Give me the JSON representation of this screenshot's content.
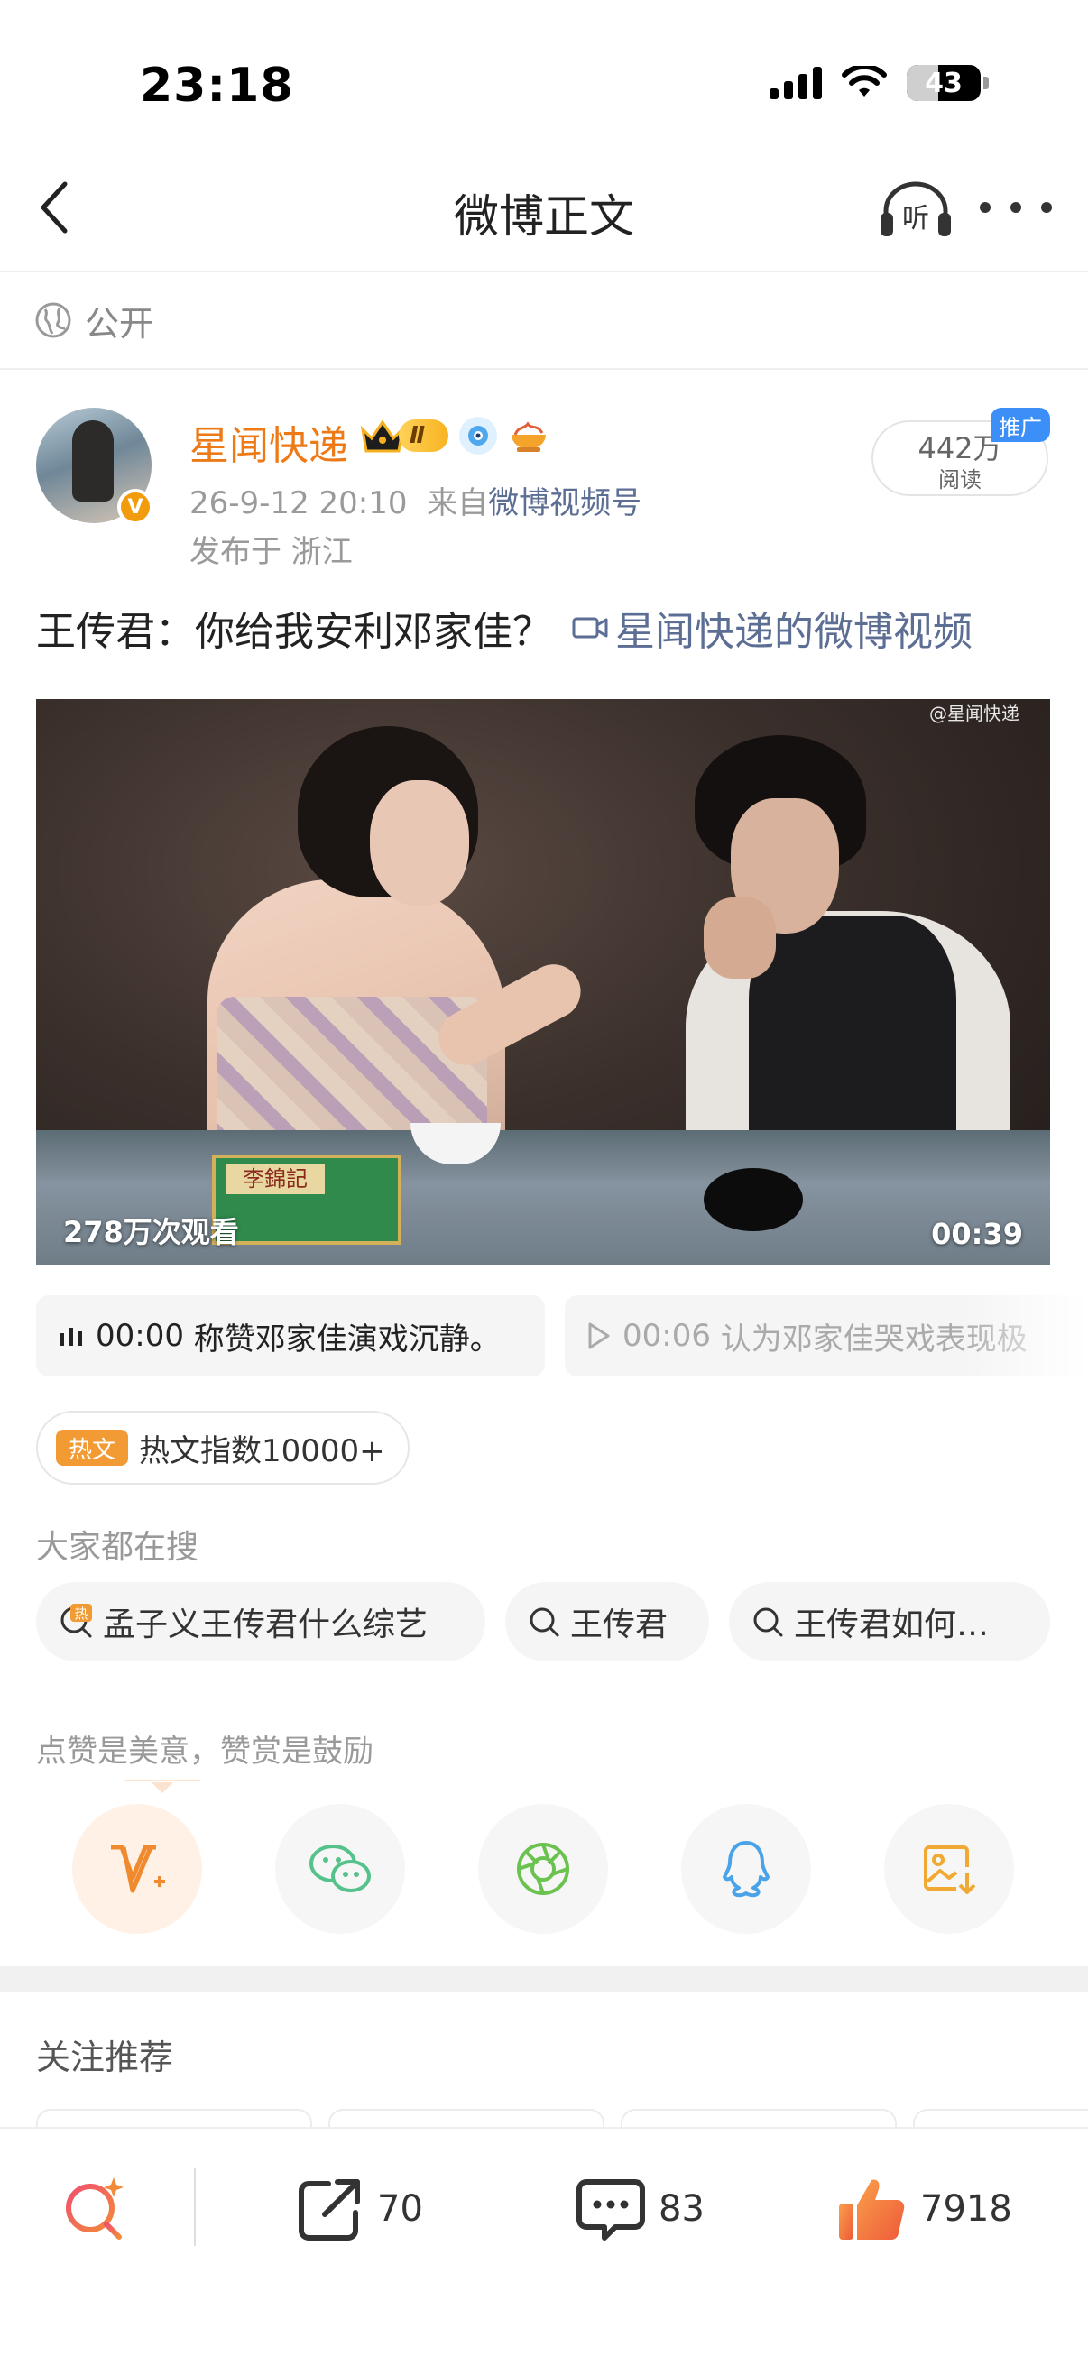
{
  "status_bar": {
    "time": "23:18",
    "battery": "43",
    "battery_level": 0.43
  },
  "nav": {
    "title": "微博正文",
    "listen_label": "听"
  },
  "visibility": {
    "label": "公开"
  },
  "author": {
    "name": "星闻快递",
    "level": "Ⅱ",
    "verified_badge": "V",
    "timestamp": "26-9-12 20:10",
    "source_prefix": "来自",
    "source": "微博视频号",
    "location": "发布于 浙江"
  },
  "reads": {
    "count": "442万",
    "label": "阅读",
    "promo_tag": "推广"
  },
  "post": {
    "text": "王传君：你给我安利邓家佳？",
    "video_link": "星闻快递的微博视频"
  },
  "video": {
    "watermark": "@星闻快递",
    "views": "278万次观看",
    "duration": "00:39",
    "tissue_label": "李錦記"
  },
  "chapters": [
    {
      "time": "00:00",
      "text": "称赞邓家佳演戏沉静。"
    },
    {
      "time": "00:06",
      "text": "认为邓家佳哭戏表现极"
    }
  ],
  "hot": {
    "badge": "热文",
    "text": "热文指数10000+"
  },
  "search": {
    "heading": "大家都在搜",
    "hot_mark": "热",
    "items": [
      "孟子义王传君什么综艺",
      "王传君",
      "王传君如何…"
    ]
  },
  "reward": {
    "text": "点赞是美意，赞赏是鼓励"
  },
  "share_icons": [
    "reward-v-icon",
    "wechat-icon",
    "moments-icon",
    "qq-icon",
    "save-image-icon"
  ],
  "follow": {
    "title": "关注推荐"
  },
  "bottom_bar": {
    "repost_count": "70",
    "comment_count": "83",
    "like_count": "7918"
  },
  "colors": {
    "brand_orange": "#ee7a17",
    "link_blue": "#5c6e93",
    "promo_blue": "#3c8ff6",
    "hot_orange": "#f29b35"
  }
}
